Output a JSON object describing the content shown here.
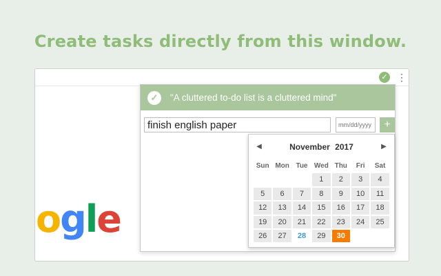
{
  "headline": "Create tasks directly from this window.",
  "toolbar": {
    "extension_icon": "check-circle-icon",
    "menu_icon": "⋮"
  },
  "logo": {
    "o": "o",
    "g": "g",
    "l": "l",
    "e": "e"
  },
  "popup": {
    "quote": "\"A cluttered to-do list is a cluttered mind\"",
    "task_value": "finish english paper",
    "date_placeholder": "mm/dd/yyyy",
    "add_label": "+"
  },
  "calendar": {
    "month": "November",
    "year": "2017",
    "weekdays": [
      "Sun",
      "Mon",
      "Tue",
      "Wed",
      "Thu",
      "Fri",
      "Sat"
    ],
    "today": 28,
    "selected": 30,
    "weeks": [
      [
        "",
        "",
        "",
        "1",
        "2",
        "3",
        "4"
      ],
      [
        "5",
        "6",
        "7",
        "8",
        "9",
        "10",
        "11"
      ],
      [
        "12",
        "13",
        "14",
        "15",
        "16",
        "17",
        "18"
      ],
      [
        "19",
        "20",
        "21",
        "22",
        "23",
        "24",
        "25"
      ],
      [
        "26",
        "27",
        "28",
        "29",
        "30",
        "",
        ""
      ]
    ]
  },
  "colors": {
    "accent": "#8fbd79",
    "quote_bar": "#a9c69c",
    "selected_day": "#f57c00",
    "today_text": "#3b9ad9"
  }
}
